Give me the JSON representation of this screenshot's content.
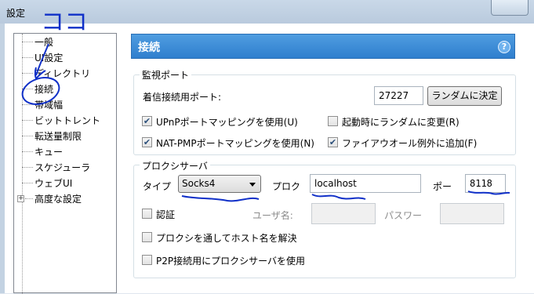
{
  "window": {
    "title": "設定"
  },
  "sidebar": {
    "items": [
      {
        "label": "一般"
      },
      {
        "label": "UI設定"
      },
      {
        "label": "ディレクトリ"
      },
      {
        "label": "接続"
      },
      {
        "label": "帯域幅"
      },
      {
        "label": "ビットトレント"
      },
      {
        "label": "転送量制限"
      },
      {
        "label": "キュー"
      },
      {
        "label": "スケジューラ"
      },
      {
        "label": "ウェブUI"
      },
      {
        "label": "高度な設定"
      }
    ]
  },
  "panel": {
    "title": "接続",
    "help_icon": "?",
    "listen": {
      "legend": "監視ポート",
      "port_label": "着信接続用ポート:",
      "port_value": "27227",
      "random_button": "ランダムに決定",
      "upnp_label": "UPnPポートマッピングを使用(U)",
      "upnp_checked": true,
      "random_start_label": "起動時にランダムに変更(R)",
      "random_start_checked": false,
      "natpmp_label": "NAT-PMPポートマッピングを使用(N)",
      "natpmp_checked": true,
      "firewall_label": "ファイアウオール例外に追加(F)",
      "firewall_checked": true
    },
    "proxy": {
      "legend": "プロクシサーバ",
      "type_label": "タイプ",
      "type_value": "Socks4",
      "proxy_label": "プロク",
      "proxy_value": "localhost",
      "port_label": "ポー",
      "port_value": "8118",
      "auth_label": "認証",
      "auth_checked": false,
      "username_label": "ユーザ名:",
      "password_label": "パスワー",
      "resolve_label": "プロクシを通してホスト名を解決",
      "resolve_checked": false,
      "p2p_label": "P2P接続用にプロクシサーバを使用",
      "p2p_checked": false
    }
  },
  "annotation": {
    "text": "ココ",
    "color": "#1030c8"
  },
  "colors": {
    "header": "#3a8bd8",
    "ink": "#1030c8"
  }
}
